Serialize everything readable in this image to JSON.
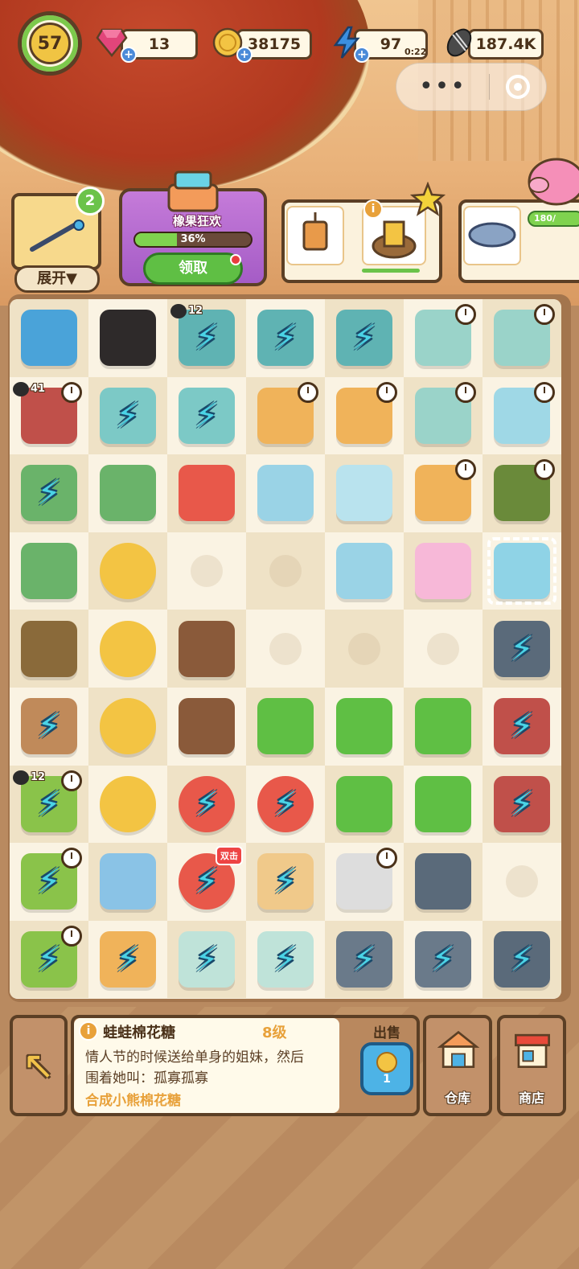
{
  "hud": {
    "level": "57",
    "gems": "13",
    "coins": "38175",
    "energy": "97",
    "energy_timer": "0:22",
    "seeds": "187.4K"
  },
  "task": {
    "count": "2",
    "expand_label": "展开▼"
  },
  "event": {
    "title": "橡果狂欢",
    "progress": "36%",
    "progress_fraction": 0.36,
    "claim_label": "领取"
  },
  "piggy": {
    "value": "180/"
  },
  "board": {
    "cells": [
      [
        "arcade",
        "black-cat",
        "fishtank-bolt-12",
        "toolbox-bolt",
        "toolbox-bolt",
        "flower-tower",
        "flower-tower"
      ],
      [
        "cleaning-cart-41",
        "shelf-bolt",
        "shelf-bolt",
        "dresser",
        "dresser",
        "flower-tower",
        "vase"
      ],
      [
        "plant-bolt",
        "plant",
        "starfish",
        "candy-jar",
        "bottle",
        "cabinet",
        "cart"
      ],
      [
        "plant-blue",
        "coins-2",
        "empty",
        "empty",
        "marshmallow",
        "cotton-candy",
        "frog-candy"
      ],
      [
        "gloves",
        "coin",
        "paw-mitt",
        "empty",
        "empty",
        "empty",
        "mine-cart-bolt"
      ],
      [
        "logs-bolt",
        "coins-3",
        "paw-mitts",
        "knife",
        "saw",
        "dustpan",
        "wheelbarrow-bolt"
      ],
      [
        "tree-bolt-12",
        "coin-pile",
        "bolt-orb-red",
        "bolt-orb-blue",
        "hand-truck",
        "hammer",
        "wheelbarrow-bolt"
      ],
      [
        "tree-bolt",
        "packet",
        "bolt-orb-gold",
        "sack-bolt",
        "robot",
        "fork",
        "empty"
      ],
      [
        "tree-bolt",
        "pot-bolt",
        "bowl-bolt",
        "bowl-bolt",
        "rover-bolt",
        "rover-bolt",
        "mine-cart-bolt"
      ]
    ],
    "cat_tags": {
      "r0c2": "12",
      "r1c0": "41",
      "r6c0": "12"
    },
    "double_label": "双击"
  },
  "info": {
    "name": "蛙蛙棉花糖",
    "level": "8级",
    "description": "情人节的时候送给单身的姐妹，然后围着她叫：孤寡孤寡",
    "merge_hint": "合成小熊棉花糖",
    "sell_label": "出售",
    "sell_price": "1"
  },
  "buttons": {
    "warehouse": "仓库",
    "shop": "商店"
  },
  "colors": {
    "board_light": "#faf3e3",
    "board_dark": "#efe2c6",
    "border_brown": "#5b3f25",
    "accent_green": "#6bc34a",
    "accent_orange": "#e8a13a"
  }
}
